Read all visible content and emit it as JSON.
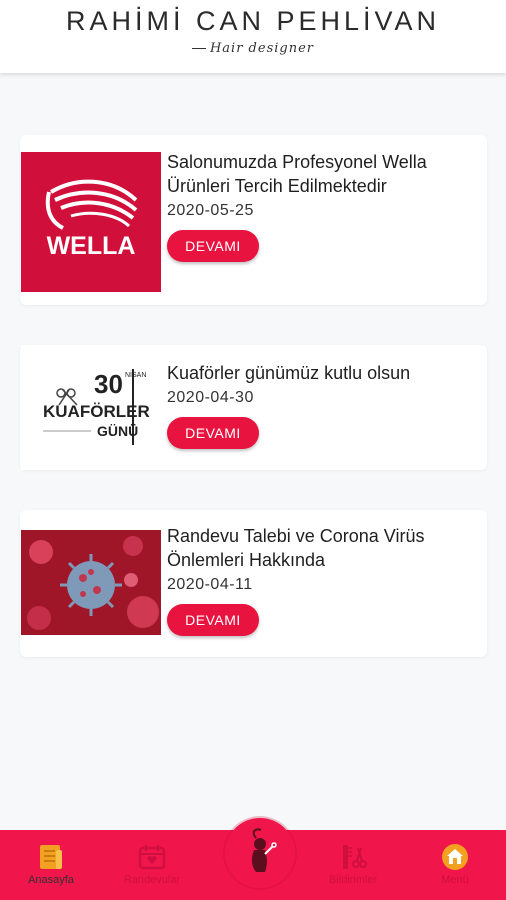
{
  "header": {
    "brand": "RAHİMİ CAN PEHLİVAN",
    "tagline": "Hair designer"
  },
  "posts": [
    {
      "title": "Salonumuzda Profesyonel Wella Ürünleri Tercih Edilmektedir",
      "date": "2020-05-25",
      "button": "DEVAMI",
      "image_text": "WELLA"
    },
    {
      "title": "Kuaförler günümüz kutlu olsun",
      "date": "2020-04-30",
      "button": "DEVAMI",
      "image_text": {
        "number": "30",
        "month": "NİSAN",
        "line1": "KUAFÖRLER",
        "line2": "GÜNÜ"
      }
    },
    {
      "title": "Randevu Talebi ve Corona Virüs Önlemleri Hakkında",
      "date": "2020-04-11",
      "button": "DEVAMI"
    }
  ],
  "bottom_nav": {
    "items": [
      {
        "label": "Anasayfa",
        "icon": "news-icon",
        "active": true
      },
      {
        "label": "Randevular",
        "icon": "calendar-icon",
        "active": false
      },
      {
        "label": "",
        "icon": "hair-stylist-icon",
        "active": false
      },
      {
        "label": "Bildirimler",
        "icon": "scissors-comb-icon",
        "active": false
      },
      {
        "label": "Menü",
        "icon": "home-menu-icon",
        "active": false
      }
    ]
  },
  "colors": {
    "accent": "#e8133f",
    "nav_background": "#f0154a",
    "wella_red": "#d0103a"
  }
}
